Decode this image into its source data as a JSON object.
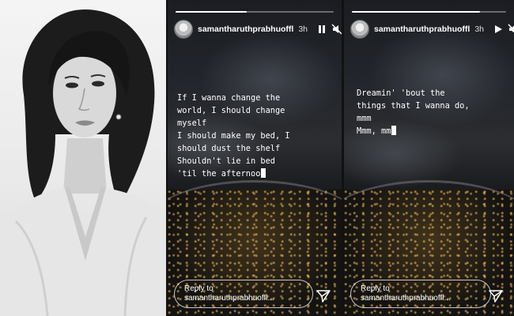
{
  "stories": [
    {
      "username": "samantharuthprabhuoffl",
      "time": "3h",
      "progress": 0.45,
      "caption_lines": [
        "If I wanna change the",
        "world, I should change",
        "myself",
        "I should make my bed, I",
        "should dust the shelf",
        "Shouldn't lie in bed",
        "'til the afternoo"
      ],
      "reply_line1": "Reply to",
      "reply_line2": "samantharuthprabhuoffl...",
      "icons": [
        "pause-icon",
        "mute-icon",
        "more-icon",
        "send-icon"
      ]
    },
    {
      "username": "samantharuthprabhuoffl",
      "time": "3h",
      "progress": 0.83,
      "caption_lines": [
        "Dreamin' 'bout the",
        "things that I wanna do,",
        "mmm",
        "Mmm, mm"
      ],
      "reply_line1": "Reply to",
      "reply_line2": "samantharuthprabhuoffl...",
      "icons": [
        "play-icon",
        "mute-icon",
        "more-icon",
        "send-icon"
      ]
    }
  ],
  "colors": {
    "text": "#ffffff",
    "background": "#1a1b1e",
    "portrait_bg": "#eeeeee"
  }
}
